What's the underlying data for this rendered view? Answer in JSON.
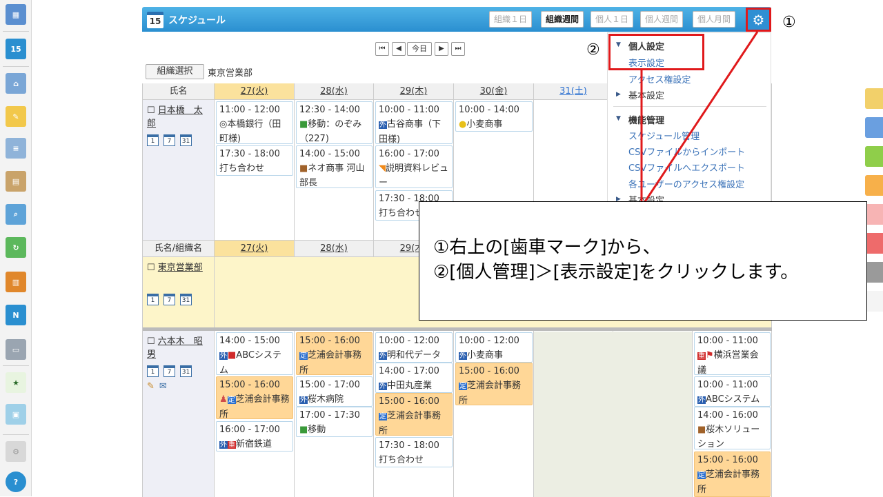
{
  "header": {
    "title": "スケジュール",
    "calendar_day": "15",
    "view_buttons": [
      "組織１日",
      "組織週間",
      "個人１日",
      "個人週間",
      "個人月間"
    ],
    "active_view": "組織週間",
    "gear_icon": "gear-icon"
  },
  "nav": {
    "first": "⏮",
    "prev": "◀",
    "today": "今日",
    "next": "▶",
    "last": "⏭"
  },
  "org": {
    "select_label": "組織選択",
    "name": "東京営業部"
  },
  "table": {
    "name_header": "氏名",
    "org_name_header": "氏名/組織名",
    "dates": [
      "27(火)",
      "28(水)",
      "29(木)",
      "30(金)",
      "31(土)"
    ]
  },
  "people": [
    {
      "name": "日本橋　太郎"
    },
    {
      "name": "東京営業部"
    },
    {
      "name": "六本木　昭男"
    }
  ],
  "events": {
    "nihonbashi": [
      {
        "time": "11:00 - 12:00",
        "title": "本橋銀行（田町様)"
      },
      {
        "time": "17:30 - 18:00",
        "title": "打ち合わせ"
      },
      {
        "time": "12:30 - 14:00",
        "title": "移動：のぞみ（227)"
      },
      {
        "time": "14:00 - 15:00",
        "title": "ネオ商事 河山部長"
      },
      {
        "time": "10:00 - 11:00",
        "title": "古谷商事（下田様)"
      },
      {
        "time": "16:00 - 17:00",
        "title": "説明資料レビュー"
      },
      {
        "time": "17:30 - 18:00",
        "title": "打ち合わせ"
      },
      {
        "time": "10:00 - 14:00",
        "title": "小麦商事"
      }
    ],
    "roppongi": [
      {
        "time": "14:00 - 15:00",
        "title": "ABCシステム"
      },
      {
        "time": "15:00 - 16:00",
        "title": "芝浦会計事務所"
      },
      {
        "time": "16:00 - 17:00",
        "title": "新宿鉄道"
      },
      {
        "time": "15:00 - 16:00",
        "title": "芝浦会計事務所"
      },
      {
        "time": "15:00 - 17:00",
        "title": "桜木病院"
      },
      {
        "time": "17:00 - 17:30",
        "title": "移動"
      },
      {
        "time": "10:00 - 12:00",
        "title": "明和代データ"
      },
      {
        "time": "14:00 - 17:00",
        "title": "中田丸産業"
      },
      {
        "time": "15:00 - 16:00",
        "title": "芝浦会計事務所"
      },
      {
        "time": "17:30 - 18:00",
        "title": "打ち合わせ"
      },
      {
        "time": "10:00 - 12:00",
        "title": "小麦商事"
      },
      {
        "time": "15:00 - 16:00",
        "title": "芝浦会計事務所"
      },
      {
        "time": "10:00 - 11:00",
        "title": "横浜営業会議"
      },
      {
        "time": "10:00 - 11:00",
        "title": "ABCシステム"
      },
      {
        "time": "14:00 - 16:00",
        "title": "桜木ソリューション"
      },
      {
        "time": "15:00 - 16:00",
        "title": "芝浦会計事務所"
      }
    ]
  },
  "dropdown": {
    "personal_header": "個人設定",
    "display_settings": "表示設定",
    "access_settings": "アクセス権設定",
    "basic_settings": "基本設定",
    "function_header": "機能管理",
    "schedule_mgmt": "スケジュール管理",
    "csv_import": "CSVファイルからインポート",
    "csv_export": "CSVファイルへエクスポート",
    "user_access": "各ユーザーのアクセス権設定",
    "basic_settings2": "基本設定"
  },
  "annotation": {
    "label1": "①",
    "label2": "②",
    "line1": "①右上の[歯車マーク]から、",
    "line2": "②[個人管理]＞[表示設定]をクリックします。"
  }
}
